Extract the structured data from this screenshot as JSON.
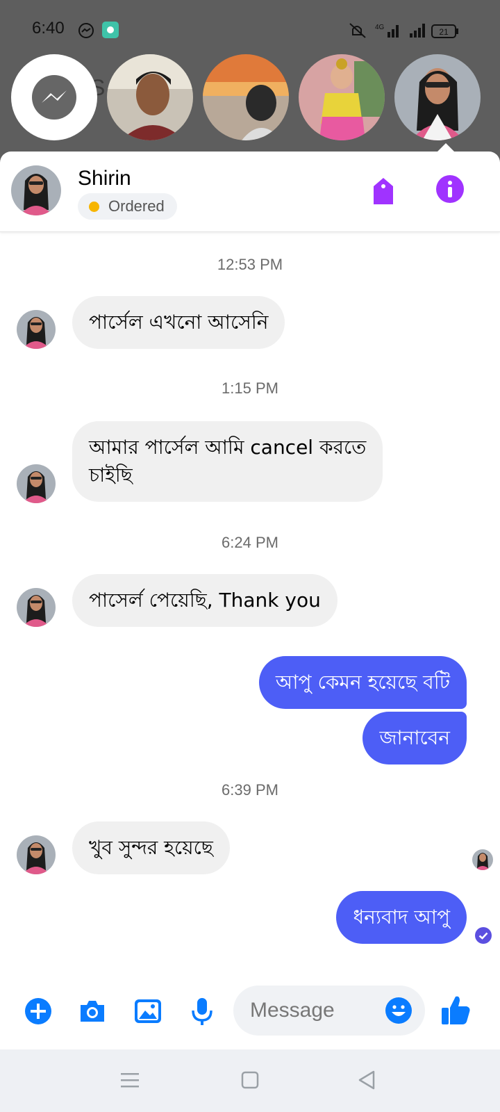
{
  "status_bar": {
    "time": "6:40",
    "battery": "21",
    "network": "4G",
    "icons": [
      "messenger-icon",
      "app-icon",
      "mute-icon",
      "signal-icon",
      "battery-icon"
    ]
  },
  "chat_heads": [
    {
      "name": "messenger-home",
      "icon": "messenger-icon"
    },
    {
      "name": "chat-head-man"
    },
    {
      "name": "chat-head-sunset"
    },
    {
      "name": "chat-head-child"
    },
    {
      "name": "chat-head-shirin"
    }
  ],
  "header": {
    "name": "Shirin",
    "status_label": "Ordered",
    "status_color": "#f7b500",
    "accent": "#a033ff"
  },
  "messages": [
    {
      "type": "timestamp",
      "text": "12:53 PM"
    },
    {
      "type": "incoming",
      "text": "পার্সেল এখনো আসেনি"
    },
    {
      "type": "timestamp",
      "text": "1:15 PM"
    },
    {
      "type": "incoming",
      "lines": [
        "আমার পার্সেল আমি cancel করতে",
        "চাইছি"
      ]
    },
    {
      "type": "timestamp",
      "text": "6:24 PM"
    },
    {
      "type": "incoming",
      "text": "পাসের্ল পেয়েছি, Thank you"
    },
    {
      "type": "outgoing",
      "text": "আপু কেমন হয়েছে বটি"
    },
    {
      "type": "outgoing",
      "text": "জানাবেন"
    },
    {
      "type": "timestamp",
      "text": "6:39 PM"
    },
    {
      "type": "incoming",
      "text": "খুব সুন্দর হয়েছে"
    },
    {
      "type": "outgoing",
      "text": "ধন্যবাদ আপু"
    }
  ],
  "composer": {
    "placeholder": "Message",
    "outgoing_color": "#4d5ef6",
    "icon_color": "#0a7cff",
    "buttons": [
      "plus-icon",
      "camera-icon",
      "gallery-icon",
      "mic-icon",
      "emoji-icon",
      "like-icon"
    ]
  },
  "navbar": {
    "buttons": [
      "menu-icon",
      "home-square-icon",
      "back-triangle-icon"
    ]
  }
}
